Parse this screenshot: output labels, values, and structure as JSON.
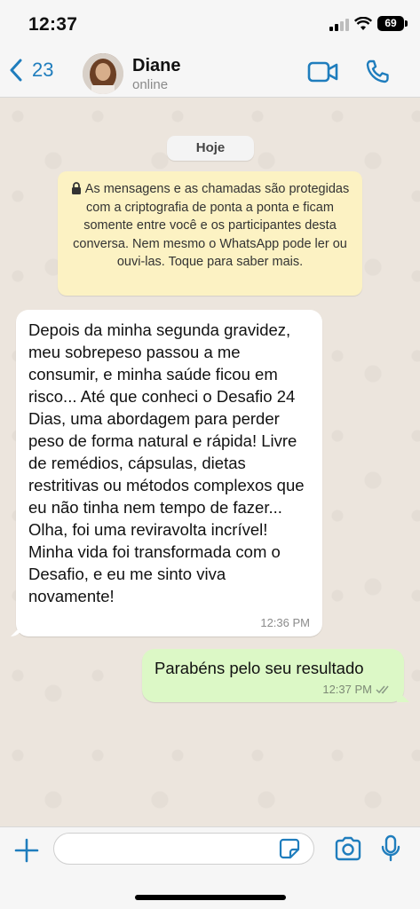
{
  "status_bar": {
    "time": "12:37",
    "battery": "69"
  },
  "header": {
    "back_count": "23",
    "contact_name": "Diane",
    "contact_status": "online"
  },
  "chat": {
    "date_chip": "Hoje",
    "encryption_note": "As mensagens e as chamadas são protegidas com a criptografia de ponta a ponta e ficam somente entre você e os participantes desta conversa. Nem mesmo o WhatsApp pode ler ou ouvi-las. Toque para saber mais.",
    "messages": [
      {
        "direction": "incoming",
        "text": "Depois da minha segunda gravidez, meu sobrepeso passou a me consumir, e minha saúde ficou em risco... Até que conheci o Desafio 24 Dias, uma abordagem para perder peso de forma natural e rápida! Livre de remédios, cápsulas, dietas restritivas ou métodos complexos que eu não tinha nem tempo de fazer... Olha, foi uma reviravolta incrível! Minha vida foi transformada com o Desafio, e eu me sinto viva novamente!",
        "time": "12:36 PM"
      },
      {
        "direction": "outgoing",
        "text": "Parabéns pelo seu resultado",
        "time": "12:37 PM"
      }
    ]
  },
  "composer": {
    "input_value": ""
  },
  "colors": {
    "accent": "#1f7dbd",
    "outgoing_bubble": "#dcf8c6",
    "incoming_bubble": "#ffffff",
    "note_bg": "#fcf2c3",
    "chat_bg": "#ece5dd"
  },
  "icons": [
    "back-chevron-icon",
    "video-call-icon",
    "phone-icon",
    "lock-icon",
    "double-check-icon",
    "plus-icon",
    "sticker-icon",
    "camera-icon",
    "microphone-icon"
  ]
}
